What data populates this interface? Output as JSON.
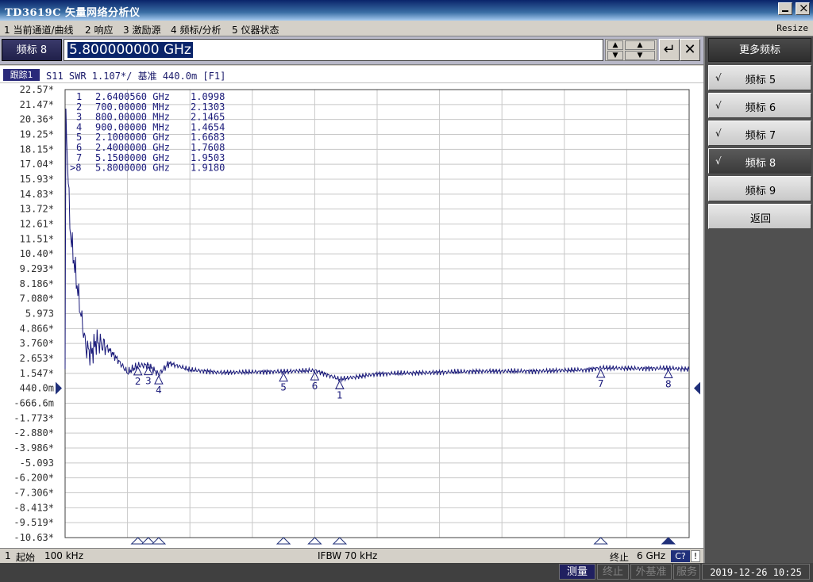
{
  "window": {
    "title": "TD3619C 矢量网络分析仪"
  },
  "menu": {
    "items": [
      "1 当前通道/曲线",
      "2 响应",
      "3 激励源",
      "4 频标/分析",
      "5 仪器状态"
    ],
    "resize": "Resize"
  },
  "entry": {
    "label": "频标 8",
    "value": "5.800000000 GHz",
    "spin_up": "▲",
    "spin_down": "▼",
    "enter_icon": "↵",
    "close_icon": "✕"
  },
  "trace_header": {
    "tag": "跟踪1",
    "text": "S11 SWR 1.107*/ 基准 440.0m [F1]"
  },
  "chart_data": {
    "type": "line",
    "xlabel": "",
    "ylabel": "",
    "x_start_hz": 100000,
    "x_stop_hz": 6000000000,
    "y_tick_labels": [
      "22.57*",
      "21.47*",
      "20.36*",
      "19.25*",
      "18.15*",
      "17.04*",
      "15.93*",
      "14.83*",
      "13.72*",
      "12.61*",
      "11.51*",
      "10.40*",
      "9.293*",
      "8.186*",
      "7.080*",
      "5.973",
      "4.866*",
      "3.760*",
      "2.653*",
      "1.547*",
      "440.0m",
      "-666.6m",
      "-1.773*",
      "-2.880*",
      "-3.986*",
      "-5.093",
      "-6.200*",
      "-7.306*",
      "-8.413*",
      "-9.519*",
      "-10.63*"
    ],
    "ylim": [
      -10.63,
      22.57
    ],
    "reference_value": 0.44,
    "grid": true,
    "series": [
      {
        "x_ghz": [
          0.0001,
          0.05,
          0.1,
          0.15,
          0.2,
          0.25,
          0.3,
          0.4,
          0.5,
          0.6,
          0.7,
          0.8,
          0.9,
          1.0,
          1.2,
          1.5,
          2.0,
          2.1,
          2.4,
          2.64,
          3.0,
          3.5,
          4.0,
          4.5,
          5.0,
          5.15,
          5.5,
          5.8,
          6.0
        ],
        "y": [
          22.0,
          12.0,
          9.0,
          6.0,
          3.5,
          3.0,
          3.9,
          3.5,
          2.6,
          1.6,
          2.13,
          2.15,
          1.47,
          2.3,
          1.8,
          1.6,
          1.67,
          1.67,
          1.76,
          1.1,
          1.5,
          1.6,
          1.7,
          1.7,
          1.8,
          1.95,
          1.9,
          1.92,
          1.85
        ]
      }
    ]
  },
  "markers": {
    "table": [
      {
        "num": "1",
        "freq": "2.6400560 GHz",
        "value": "1.0998"
      },
      {
        "num": "2",
        "freq": "700.00000 MHz",
        "value": "2.1303"
      },
      {
        "num": "3",
        "freq": "800.00000 MHz",
        "value": "2.1465"
      },
      {
        "num": "4",
        "freq": "900.00000 MHz",
        "value": "1.4654"
      },
      {
        "num": "5",
        "freq": "2.1000000 GHz",
        "value": "1.6683"
      },
      {
        "num": "6",
        "freq": "2.4000000 GHz",
        "value": "1.7608"
      },
      {
        "num": "7",
        "freq": "5.1500000 GHz",
        "value": "1.9503"
      },
      {
        "num": ">8",
        "freq": "5.8000000 GHz",
        "value": "1.9180"
      }
    ],
    "labels": [
      "1",
      "2",
      "3",
      "4",
      "5",
      "6",
      "7",
      "8"
    ],
    "freqs_ghz": [
      2.640056,
      0.7,
      0.8,
      0.9,
      2.1,
      2.4,
      5.15,
      5.8
    ],
    "values": [
      1.0998,
      2.1303,
      2.1465,
      1.4654,
      1.6683,
      1.7608,
      1.9503,
      1.918
    ]
  },
  "status": {
    "channel": "1",
    "start_label": "起始",
    "start_value": "100 kHz",
    "ifbw": "IFBW 70 kHz",
    "stop_label": "终止",
    "stop_value": "6 GHz",
    "cp": "C?",
    "bang": "!"
  },
  "softkeys": {
    "header": "更多频标",
    "items": [
      {
        "label": "频标 5",
        "checked": "√"
      },
      {
        "label": "频标 6",
        "checked": "√"
      },
      {
        "label": "频标 7",
        "checked": "√"
      },
      {
        "label": "频标 8",
        "checked": "√"
      },
      {
        "label": "频标 9",
        "checked": ""
      },
      {
        "label": "返回",
        "checked": ""
      }
    ]
  },
  "sysbar": {
    "buttons": [
      "测量",
      "终止",
      "外基准",
      "服务"
    ],
    "clock": "2019-12-26 10:25"
  },
  "colors": {
    "trace": "#1a1a7a",
    "grid": "#c8c8c8",
    "accent": "#20307a"
  }
}
